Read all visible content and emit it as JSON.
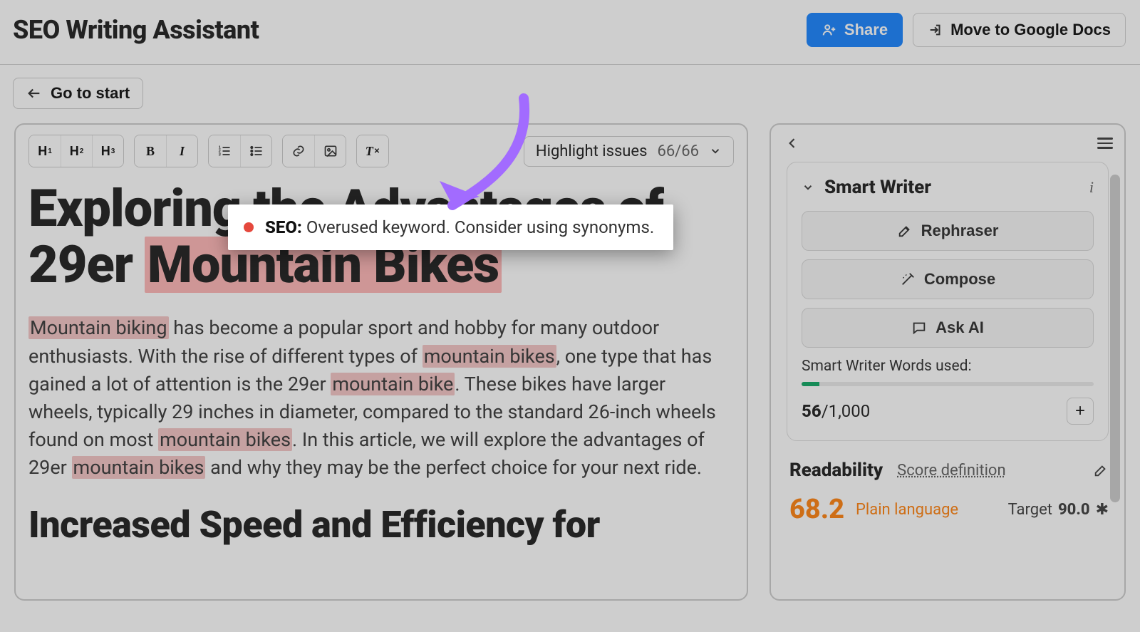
{
  "header": {
    "title": "SEO Writing Assistant",
    "share_label": "Share",
    "move_label": "Move to Google Docs"
  },
  "subheader": {
    "goto_label": "Go to start"
  },
  "toolbar": {
    "highlight_label": "Highlight issues",
    "issue_count": "66/66"
  },
  "article": {
    "h1_pre": "Exploring the Advantages of 29er ",
    "h1_hl": "Mountain Bikes",
    "p1_seg1": "Mountain biking",
    "p1_seg2": " has become a popular sport and hobby for many outdoor enthusiasts. With the rise of different types of ",
    "p1_seg3": "mountain bikes",
    "p1_seg4": ", one type that has gained a lot of attention is the 29er ",
    "p1_seg5": "mountain bike",
    "p1_seg6": ". These bikes have larger wheels, typically 29 inches in diameter, compared to the standard 26-inch wheels found on most ",
    "p1_seg7": "mountain bikes",
    "p1_seg8": ". In this article, we will explore the advantages of 29er ",
    "p1_seg9": "mountain bikes",
    "p1_seg10": " and why they may be the perfect choice for your next ride.",
    "h2": "Increased Speed and Efficiency for"
  },
  "tooltip": {
    "label": "SEO:",
    "message": "Overused keyword. Consider using synonyms."
  },
  "side": {
    "smart_writer_title": "Smart Writer",
    "rephraser": "Rephraser",
    "compose": "Compose",
    "ask_ai": "Ask AI",
    "usage_label": "Smart Writer Words used:",
    "usage_used": "56",
    "usage_sep": "/",
    "usage_total": "1,000",
    "readability_title": "Readability",
    "score_def": "Score definition",
    "score_value": "68.2",
    "plain_lang": "Plain language",
    "target_label": "Target",
    "target_value": "90.0",
    "snow": "✱"
  }
}
